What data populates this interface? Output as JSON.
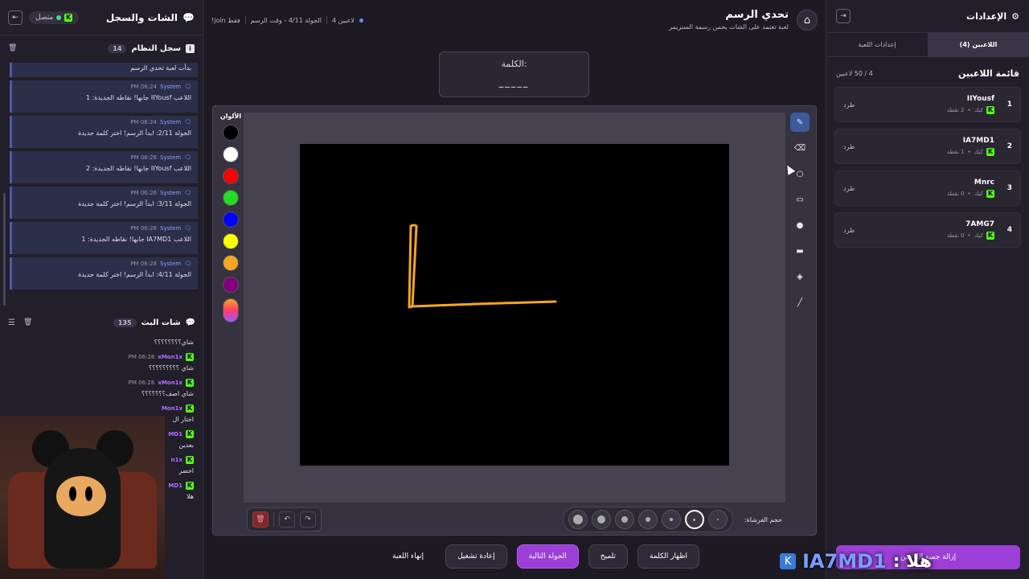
{
  "left_panel": {
    "title": "الشات والسجل",
    "status": "متصل",
    "system_log": {
      "title": "سجل النظام",
      "count": "14",
      "first_text": "بدأت لعبة تحدي الرسم",
      "items": [
        {
          "user": "System",
          "time": "06:24 PM",
          "text": "اللاعب IIYousf جابها! نقاطه الجديدة: 1"
        },
        {
          "user": "System",
          "time": "06:24 PM",
          "text": "الجولة 2/11: ابدأ الرسم! اختر كلمة جديدة"
        },
        {
          "user": "System",
          "time": "06:26 PM",
          "text": "اللاعب IIYousf جابها! نقاطه الجديدة: 2"
        },
        {
          "user": "System",
          "time": "06:26 PM",
          "text": "الجولة 3/11: ابدأ الرسم! اختر كلمة جديدة"
        },
        {
          "user": "System",
          "time": "06:28 PM",
          "text": "اللاعب IA7MD1 جابها! نقاطه الجديدة: 1"
        },
        {
          "user": "System",
          "time": "06:28 PM",
          "text": "الجولة 4/11: ابدأ الرسم! اختر كلمة جديدة"
        }
      ]
    },
    "stream_chat": {
      "title": "شات البث",
      "count": "135",
      "items": [
        {
          "user": "",
          "time": "",
          "text": "شاي؟؟؟؟؟؟؟؟"
        },
        {
          "user": "xMon1x",
          "time": "06:28 PM",
          "text": "شاي ؟؟؟؟؟؟؟؟؟"
        },
        {
          "user": "xMon1x",
          "time": "06:28 PM",
          "text": "شاي اصف؟؟؟؟؟؟؟"
        },
        {
          "user": "Mon1x",
          "time": "",
          "text": "اختار ال"
        },
        {
          "user": "MD1",
          "time": "",
          "text": "بعدين"
        },
        {
          "user": "n1x",
          "time": "",
          "text": "اخضر"
        },
        {
          "user": "MD1",
          "time": "",
          "text": "هلا"
        }
      ]
    }
  },
  "header": {
    "title": "تحدي الرسم",
    "subtitle": "لعبة تعتمد على الشات يخمن رسمة الستريمر",
    "players": "4 لاعبين",
    "round": "الجولة 4/11 - وقت الرسم",
    "join": "!join فقط"
  },
  "word_box": {
    "label": "الكلمة:",
    "blank": "_____"
  },
  "palette": {
    "title": "الألوان",
    "colors": [
      "#000000",
      "#ffffff",
      "#ff0000",
      "#22dd22",
      "#0000ff",
      "#ffff00",
      "#f5a623",
      "#800080"
    ]
  },
  "brush": {
    "label": "حجم الفرشاة:",
    "selected_index": 1
  },
  "drawing": {
    "stroke_color": "#f5a623"
  },
  "actions": {
    "reveal_word": "اظهار الكلمة",
    "hint": "تلميح",
    "next_round": "الجولة التالية",
    "restart": "إعادة تشغيل",
    "end_game": "إنهاء اللعبة"
  },
  "right_panel": {
    "title": "الإعدادات",
    "tabs": [
      "اللاعبين (4)",
      "إعدادات اللعبة"
    ],
    "players_title": "قائمة اللاعبين",
    "players_count": "4 / 50 لاعبين",
    "kick_label": "طرد",
    "platform_label": "كيك",
    "players": [
      {
        "rank": "1",
        "name": "IIYousf",
        "points": "2 نقطة"
      },
      {
        "rank": "2",
        "name": "IA7MD1",
        "points": "1 نقطة"
      },
      {
        "rank": "3",
        "name": "Mnrc",
        "points": "0 نقطة"
      },
      {
        "rank": "4",
        "name": "7AMG7",
        "points": "0 نقطة"
      }
    ],
    "remove_all": "إزالة جميع اللاعبين"
  },
  "overlay": {
    "greeting": "هلا :",
    "handle": "IA7MD1"
  }
}
